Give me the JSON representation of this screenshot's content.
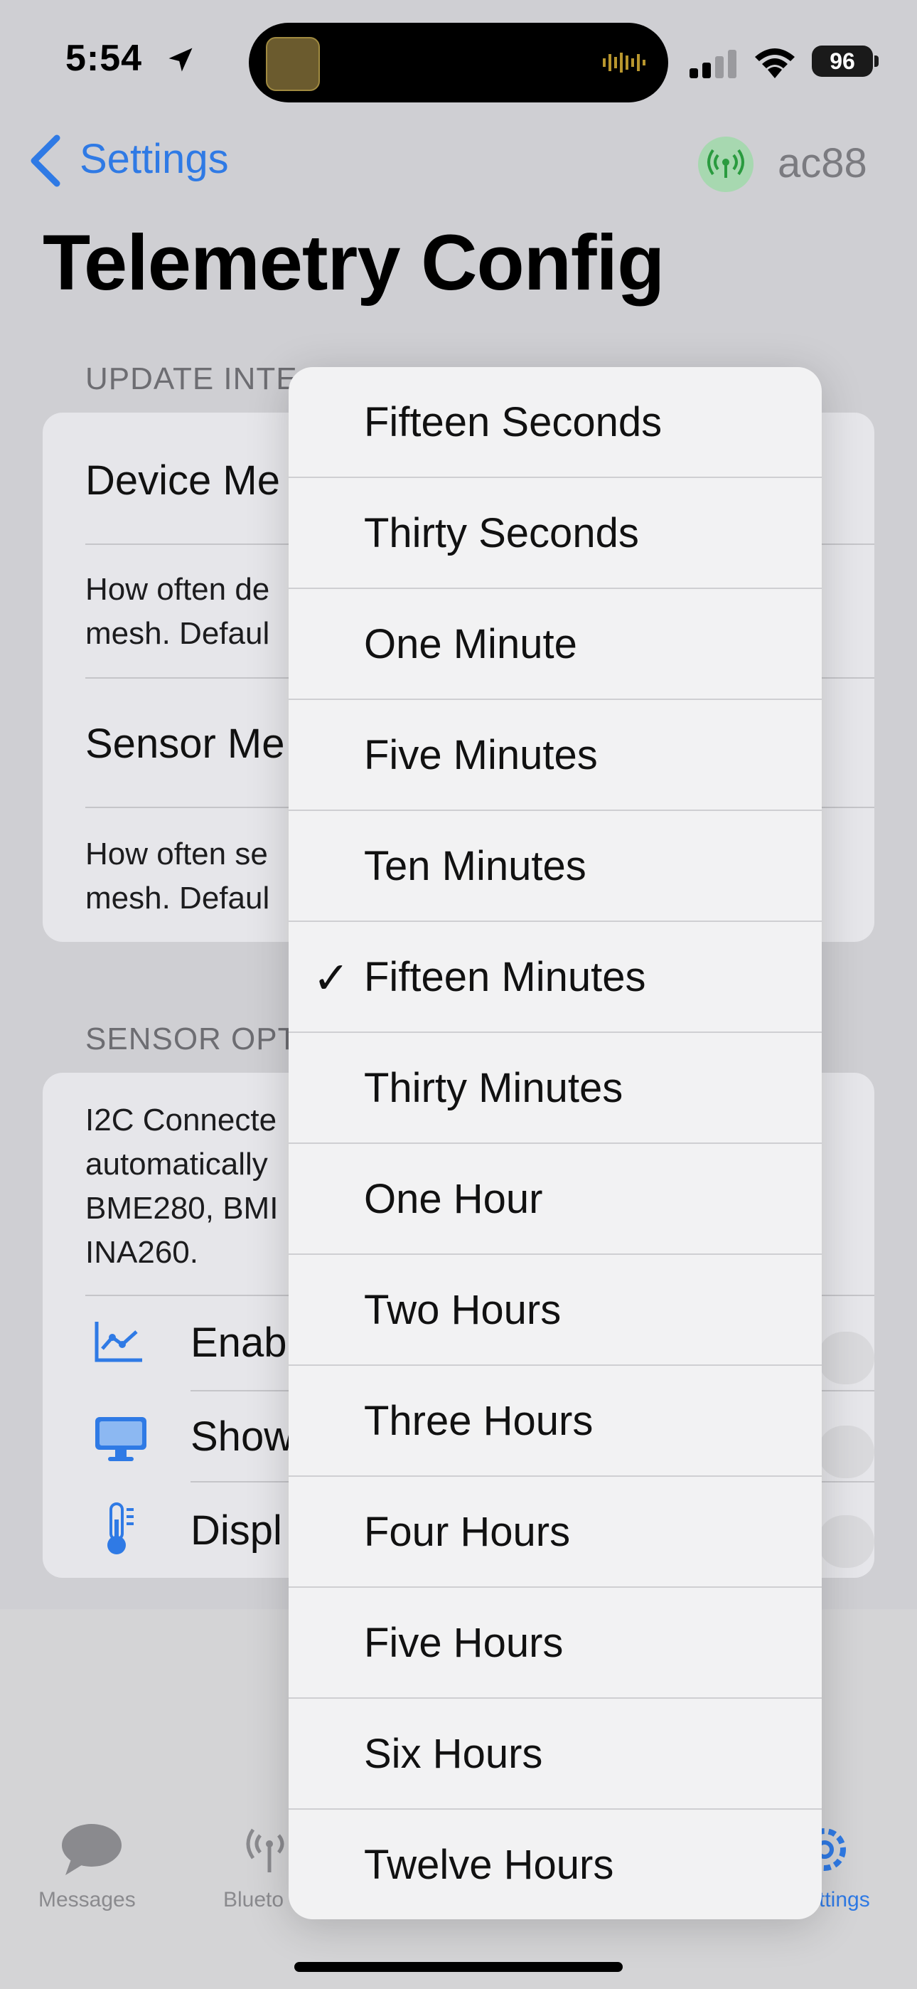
{
  "status_bar": {
    "time": "5:54",
    "battery": "96"
  },
  "nav": {
    "back_label": "Settings",
    "node_name": "ac88"
  },
  "page": {
    "title": "Telemetry Config"
  },
  "sections": {
    "update_intervals": {
      "header": "UPDATE INTE",
      "row1_title": "Device Me",
      "row1_desc_l1": "How often de",
      "row1_desc_l2": "mesh. Defaul",
      "row2_title": "Sensor Me",
      "row2_desc_l1": "How often se",
      "row2_desc_l2": "mesh. Defaul"
    },
    "sensor_options": {
      "header": "SENSOR OPT",
      "desc_l1": "I2C Connecte",
      "desc_l2": "automatically",
      "desc_l3": "BME280, BMI",
      "desc_l4": "INA260.",
      "toggle1_label": "Enab",
      "toggle2_label": "Show",
      "toggle3_label": "Displ"
    }
  },
  "tabbar": {
    "messages": "Messages",
    "bluetooth": "Blueto",
    "settings": "ttings"
  },
  "menu": {
    "selected": "Fifteen Minutes",
    "items": [
      {
        "label": "Fifteen Seconds",
        "check": ""
      },
      {
        "label": "Thirty Seconds",
        "check": ""
      },
      {
        "label": "One Minute",
        "check": ""
      },
      {
        "label": "Five Minutes",
        "check": ""
      },
      {
        "label": "Ten Minutes",
        "check": ""
      },
      {
        "label": "Fifteen Minutes",
        "check": "✓"
      },
      {
        "label": "Thirty Minutes",
        "check": ""
      },
      {
        "label": "One Hour",
        "check": ""
      },
      {
        "label": "Two Hours",
        "check": ""
      },
      {
        "label": "Three Hours",
        "check": ""
      },
      {
        "label": "Four Hours",
        "check": ""
      },
      {
        "label": "Five Hours",
        "check": ""
      },
      {
        "label": "Six Hours",
        "check": ""
      },
      {
        "label": "Twelve Hours",
        "check": ""
      }
    ]
  },
  "colors": {
    "accent": "#2f7ae5",
    "background": "#cfcfd3",
    "menu": "#f2f2f3"
  }
}
